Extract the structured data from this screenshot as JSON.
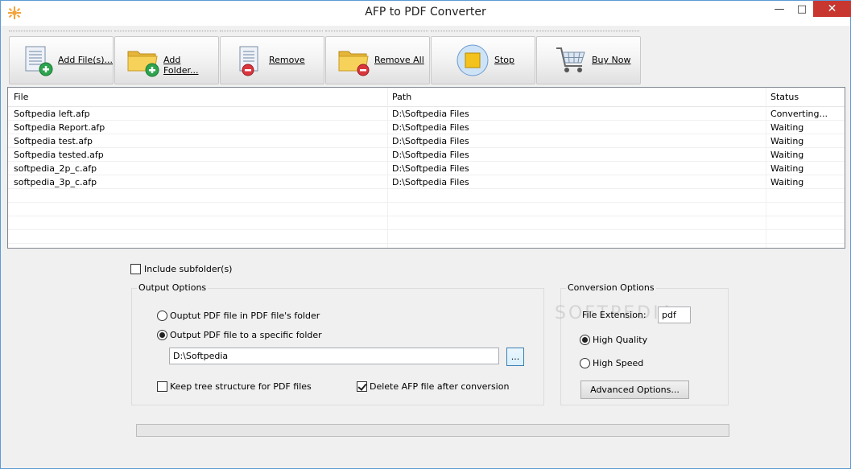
{
  "window": {
    "title": "AFP to PDF Converter",
    "min": "—",
    "max": "□",
    "close": "✕",
    "accent": "#c7372f"
  },
  "toolbar": {
    "buttons": [
      {
        "label": "Add File(s)...",
        "icon": "add-file-icon"
      },
      {
        "label": "Add Folder...",
        "icon": "add-folder-icon"
      },
      {
        "label": "Remove",
        "icon": "remove-file-icon"
      },
      {
        "label": "Remove All",
        "icon": "remove-all-icon"
      },
      {
        "label": "Stop",
        "icon": "stop-icon"
      },
      {
        "label": "Buy Now",
        "icon": "shopping-cart-icon"
      }
    ]
  },
  "filelist": {
    "columns": [
      "File",
      "Path",
      "Status"
    ],
    "rows": [
      {
        "file": "Softpedia left.afp",
        "path": "D:\\Softpedia Files",
        "status": "Converting..."
      },
      {
        "file": "Softpedia Report.afp",
        "path": "D:\\Softpedia Files",
        "status": "Waiting"
      },
      {
        "file": "Softpedia test.afp",
        "path": "D:\\Softpedia Files",
        "status": "Waiting"
      },
      {
        "file": "Softpedia tested.afp",
        "path": "D:\\Softpedia Files",
        "status": "Waiting"
      },
      {
        "file": "softpedia_2p_c.afp",
        "path": "D:\\Softpedia Files",
        "status": "Waiting"
      },
      {
        "file": "softpedia_3p_c.afp",
        "path": "D:\\Softpedia Files",
        "status": "Waiting"
      }
    ]
  },
  "options": {
    "include_subfolders": "Include subfolder(s)",
    "output_group": "Output Options",
    "radio_same_folder": "Ouptut PDF file in PDF file's folder",
    "radio_specific_folder": "Output PDF file to a specific folder",
    "output_folder": "D:\\Softpedia",
    "browse": "...",
    "keep_tree": "Keep tree structure for PDF files",
    "delete_afp": "Delete AFP file after conversion",
    "conversion_group": "Conversion Options",
    "file_extension_label": "File Extension:",
    "file_extension_value": "pdf",
    "high_quality": "High Quality",
    "high_speed": "High Speed",
    "advanced": "Advanced Options..."
  },
  "watermark": "SOFTPEDIA",
  "progress": {
    "value": 0
  }
}
